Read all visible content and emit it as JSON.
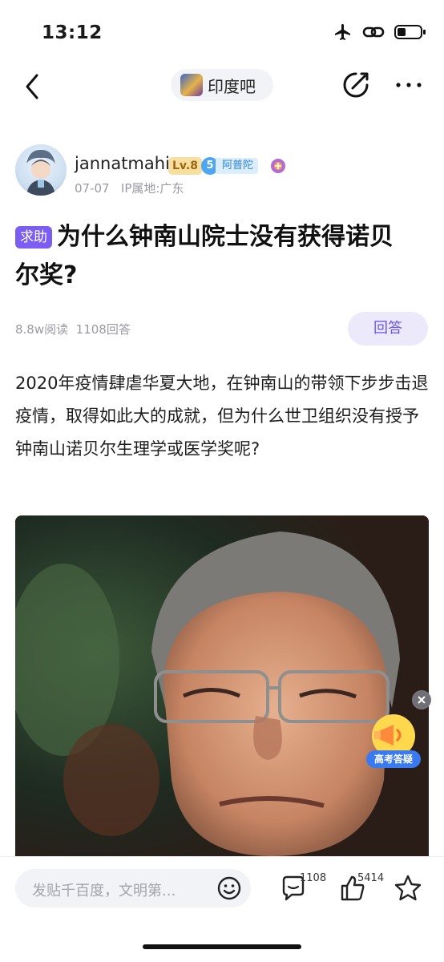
{
  "status_bar": {
    "time": "13:12",
    "icons": [
      "airplane-icon",
      "link-icon",
      "battery-icon"
    ]
  },
  "nav": {
    "back_icon": "chevron-left-icon",
    "forum_name": "印度吧",
    "edit_icon": "edit-icon",
    "more_icon": "more-dots-icon"
  },
  "author": {
    "name": "jannatmahi",
    "level": "Lv.8",
    "rank_number": "5",
    "rank_label": "阿普陀",
    "date": "07-07",
    "ip_location": "IP属地:广东"
  },
  "post": {
    "tag": "求助",
    "title": "为什么钟南山院士没有获得诺贝尔奖?",
    "stats": "8.8w阅读  1108回答",
    "answer_button": "回答",
    "body": "2020年疫情肆虐华夏大地，在钟南山的带领下步步击退疫情，取得如此大的成就，但为什么世卫组织没有授予钟南山诺贝尔生理学或医学奖呢?"
  },
  "promo": {
    "label": "高考答疑"
  },
  "bottom_bar": {
    "input_placeholder": "发贴千百度，文明第...",
    "comment_count": "1108",
    "like_count": "5414"
  },
  "colors": {
    "accent": "#7b5df1",
    "accent_light": "#ece9fb",
    "meta_text": "#9a9aa4"
  }
}
